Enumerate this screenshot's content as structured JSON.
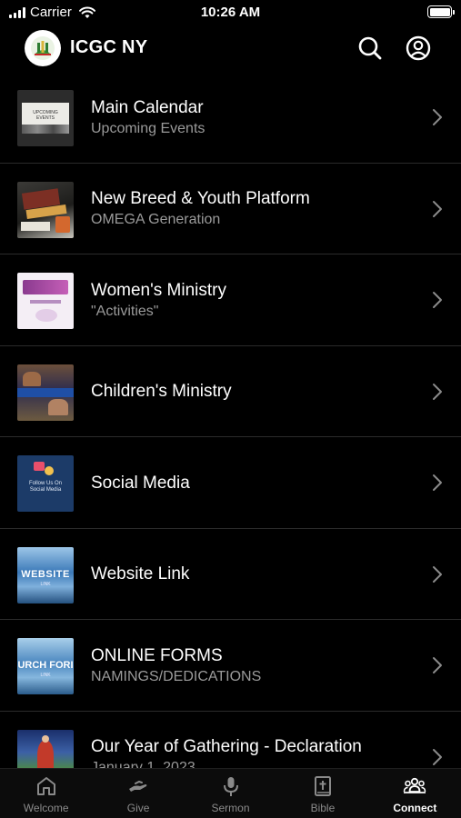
{
  "status_bar": {
    "carrier": "Carrier",
    "time": "10:26 AM",
    "battery_level": 1.0
  },
  "header": {
    "title": "ICGC NY",
    "logo_icon": "church-logo-icon",
    "search_icon": "search-icon",
    "account_icon": "account-circle-icon"
  },
  "list": {
    "items": [
      {
        "title": "Main Calendar",
        "subtitle": "Upcoming Events",
        "thumb_text": "UPCOMING EVENTS"
      },
      {
        "title": "New Breed & Youth Platform",
        "subtitle": "OMEGA Generation"
      },
      {
        "title": "Women's Ministry",
        "subtitle": "\"Activities\""
      },
      {
        "title": "Children's Ministry",
        "subtitle": ""
      },
      {
        "title": "Social Media",
        "subtitle": "",
        "thumb_text": "Follow Us On Social Media"
      },
      {
        "title": "Website Link",
        "subtitle": "",
        "thumb_text": "WEBSITE",
        "thumb_sub": "LINK"
      },
      {
        "title": "ONLINE FORMS",
        "subtitle": "NAMINGS/DEDICATIONS",
        "thumb_text": "URCH FORI",
        "thumb_sub": "LINK"
      },
      {
        "title": "Our Year of Gathering - Declaration",
        "subtitle": "January 1, 2023"
      }
    ]
  },
  "tabs": [
    {
      "label": "Welcome",
      "icon": "home-icon",
      "active": false
    },
    {
      "label": "Give",
      "icon": "give-hand-icon",
      "active": false
    },
    {
      "label": "Sermon",
      "icon": "microphone-icon",
      "active": false
    },
    {
      "label": "Bible",
      "icon": "bible-icon",
      "active": false
    },
    {
      "label": "Connect",
      "icon": "group-icon",
      "active": true
    }
  ],
  "colors": {
    "background": "#000000",
    "subtitle": "#9a9a9a",
    "divider": "#2b2b2b",
    "tab_inactive": "#8a8a8a",
    "tab_active": "#ffffff"
  }
}
